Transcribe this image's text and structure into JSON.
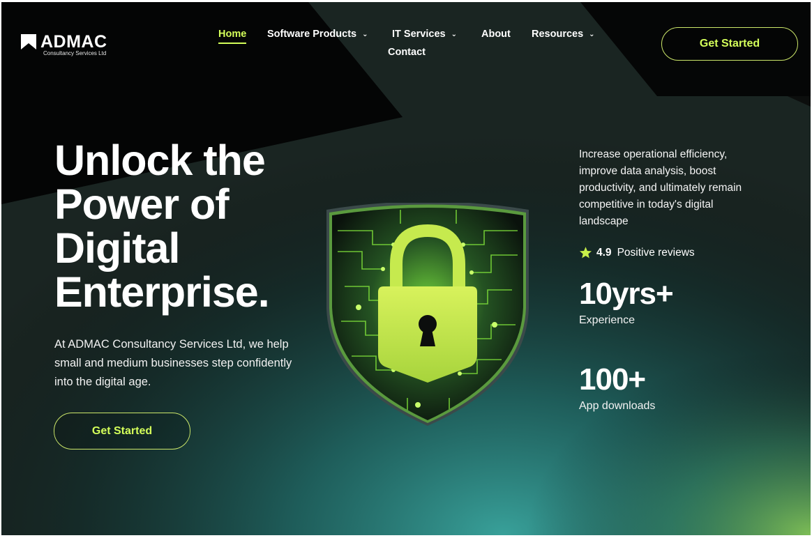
{
  "brand": {
    "name": "ADMAC",
    "subtitle": "Consultancy Services Ltd"
  },
  "nav": {
    "items": [
      {
        "label": "Home",
        "active": true,
        "has_dropdown": false
      },
      {
        "label": "Software Products",
        "active": false,
        "has_dropdown": true
      },
      {
        "label": "IT Services",
        "active": false,
        "has_dropdown": true
      },
      {
        "label": "About",
        "active": false,
        "has_dropdown": false
      },
      {
        "label": "Resources",
        "active": false,
        "has_dropdown": true
      },
      {
        "label": "Contact",
        "active": false,
        "has_dropdown": false
      }
    ],
    "chevron": "⌄"
  },
  "header_cta": {
    "label": "Get Started"
  },
  "hero": {
    "title": "Unlock the Power of Digital Enterprise.",
    "description": "At ADMAC Consultancy Services Ltd, we help small and medium businesses step confidently into the digital age.",
    "cta_label": "Get Started",
    "image_icon": "padlock-shield-icon"
  },
  "side": {
    "description": "Increase operational efficiency, improve data analysis, boost productivity, and ultimately remain competitive in today's digital landscape",
    "rating": {
      "value": "4.9",
      "label": "Positive reviews",
      "icon": "star-icon"
    },
    "stats": [
      {
        "value": "10yrs+",
        "label": "Experience"
      },
      {
        "value": "100+",
        "label": "App downloads"
      }
    ]
  },
  "colors": {
    "accent": "#d4ff5a",
    "background": "#0c0e0d",
    "shield_green": "#8fe03a",
    "teal_glow": "#2a8a86"
  }
}
